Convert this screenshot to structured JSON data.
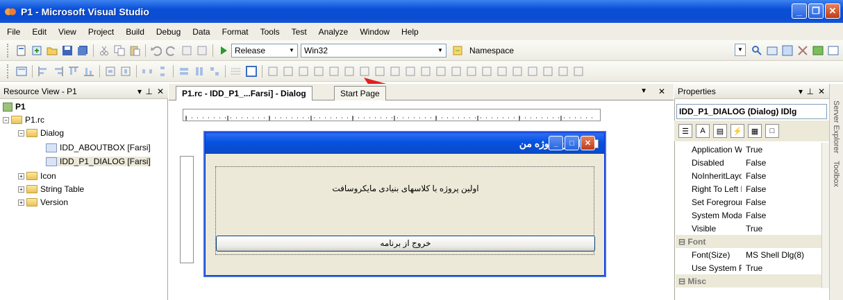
{
  "window": {
    "title": "P1 - Microsoft Visual Studio"
  },
  "menu": [
    "File",
    "Edit",
    "View",
    "Project",
    "Build",
    "Debug",
    "Data",
    "Format",
    "Tools",
    "Test",
    "Analyze",
    "Window",
    "Help"
  ],
  "toolbar": {
    "config": "Release",
    "platform": "Win32",
    "namespace": "Namespace"
  },
  "resource_view": {
    "title": "Resource View - P1",
    "tree": {
      "project": "P1",
      "rc": "P1.rc",
      "dialog_folder": "Dialog",
      "dialog_items": [
        "IDD_ABOUTBOX [Farsi]",
        "IDD_P1_DIALOG [Farsi]"
      ],
      "others": [
        "Icon",
        "String Table",
        "Version"
      ]
    }
  },
  "editor": {
    "tab_active": "P1.rc - IDD_P1_...Farsi] - Dialog",
    "tab_other": "Start Page"
  },
  "dialog": {
    "title": "اولین پروژه من",
    "label": "اولین پروژه با کلاسهای بنیادی مایکروسافت",
    "button": "خروج از برنامه"
  },
  "properties": {
    "title": "Properties",
    "selected": "IDD_P1_DIALOG (Dialog) IDlg",
    "rows": [
      {
        "k": "Application Win",
        "v": "True"
      },
      {
        "k": "Disabled",
        "v": "False"
      },
      {
        "k": "NoInheritLayout",
        "v": "False"
      },
      {
        "k": "Right To Left R",
        "v": "False"
      },
      {
        "k": "Set Foreground",
        "v": "False"
      },
      {
        "k": "System Modal",
        "v": "False"
      },
      {
        "k": "Visible",
        "v": "True"
      }
    ],
    "cat_font": "Font",
    "font_rows": [
      {
        "k": "Font(Size)",
        "v": "MS Shell Dlg(8)"
      },
      {
        "k": "Use System Font",
        "v": "True"
      }
    ],
    "cat_misc": "Misc"
  },
  "sidebar_tabs": {
    "server": "Server Explorer",
    "toolbox": "Toolbox"
  },
  "colors": {
    "titlebar": "#0a4fd8",
    "accent_arrow": "#e02020"
  }
}
